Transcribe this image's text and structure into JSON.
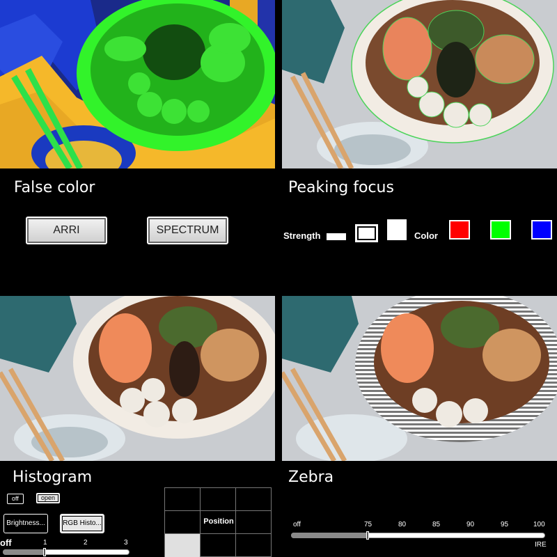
{
  "panels": {
    "false_color": {
      "title": "False color",
      "buttons": {
        "arri": "ARRI",
        "spectrum": "SPECTRUM"
      }
    },
    "peaking_focus": {
      "title": "Peaking focus",
      "strength_label": "Strength",
      "color_label": "Color",
      "colors": {
        "red": "#ff0000",
        "green": "#00ff00",
        "blue": "#0000ff"
      }
    },
    "histogram": {
      "title": "Histogram",
      "off_label": "off",
      "open_label": "open",
      "brightness_label": "Brightness...",
      "rgb_label": "RGB Histo...",
      "slider_ticks": [
        "off",
        "1",
        "2",
        "3"
      ],
      "slider_value": 0.33
    },
    "position": {
      "label": "Position"
    },
    "zebra": {
      "title": "Zebra",
      "ticks": [
        "off",
        "75",
        "80",
        "85",
        "90",
        "95",
        "100"
      ],
      "unit": "IRE",
      "slider_value": 0.3
    }
  }
}
